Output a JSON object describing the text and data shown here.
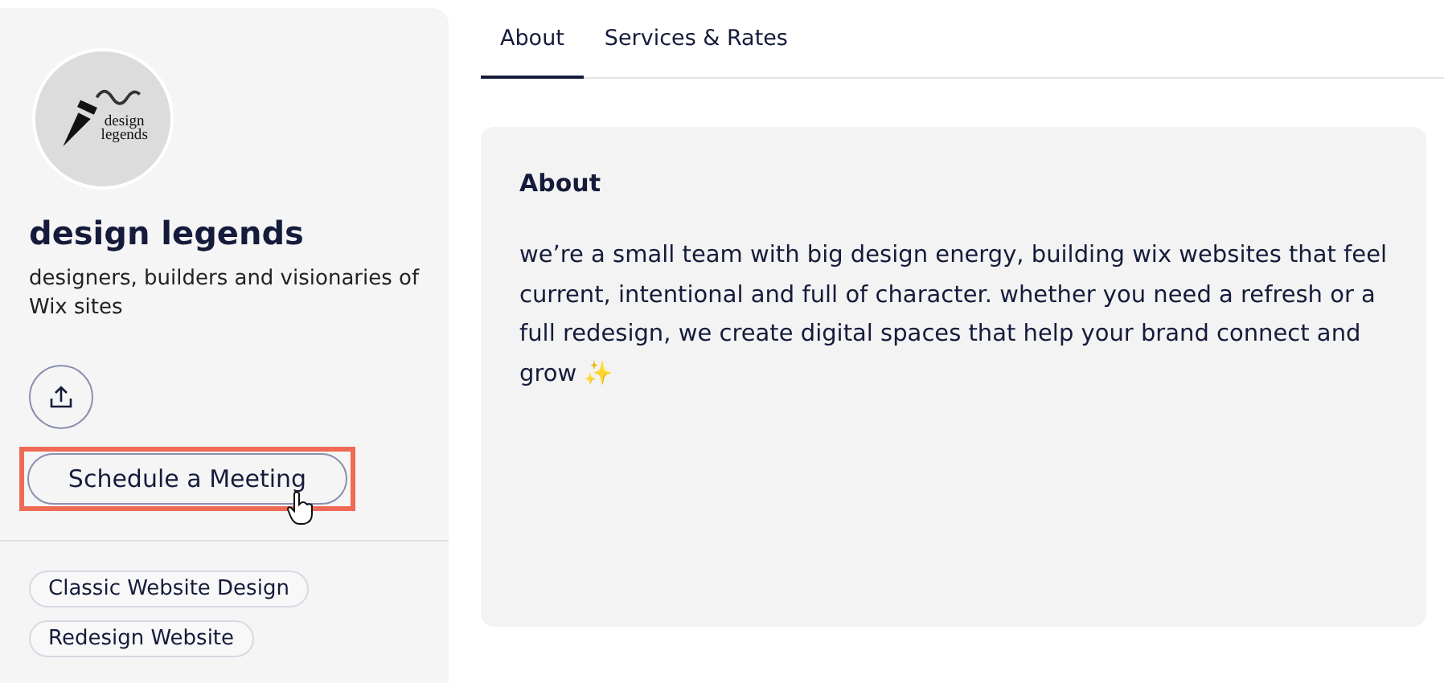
{
  "profile": {
    "logo_text": [
      "design",
      "legends"
    ],
    "name": "design legends",
    "tagline": "designers, builders and visionaries of Wix sites"
  },
  "actions": {
    "primary": "Schedule a Meeting"
  },
  "tags": [
    "Classic Website Design",
    "Redesign Website"
  ],
  "tabs": [
    {
      "label": "About",
      "selected": true
    },
    {
      "label": "Services & Rates",
      "selected": false
    }
  ],
  "about": {
    "title": "About",
    "text": "we’re a small team with big design energy, building wix websites that feel current, intentional and full of character. whether you need a refresh or a full redesign, we create digital spaces that help your brand connect and grow ✨"
  }
}
